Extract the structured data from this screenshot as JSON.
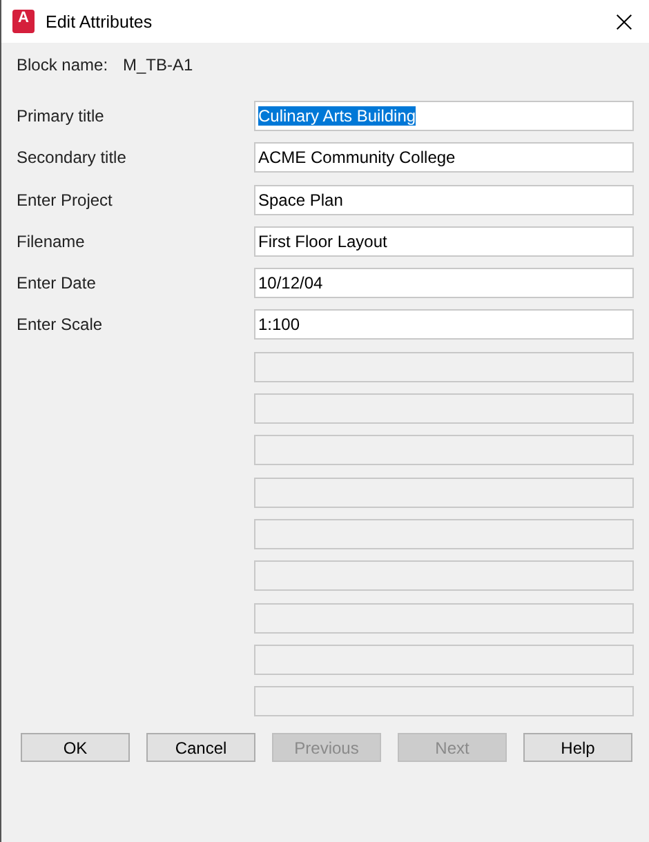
{
  "window": {
    "title": "Edit Attributes",
    "icon_letter": "A"
  },
  "block_name": {
    "label": "Block name:",
    "value": "M_TB-A1"
  },
  "fields": [
    {
      "label": "Primary title",
      "value": "Culinary Arts Building",
      "selected": true,
      "disabled": false
    },
    {
      "label": "Secondary title",
      "value": "ACME Community College",
      "selected": false,
      "disabled": false
    },
    {
      "label": "Enter Project",
      "value": "Space Plan",
      "selected": false,
      "disabled": false
    },
    {
      "label": "Filename",
      "value": "First Floor Layout",
      "selected": false,
      "disabled": false
    },
    {
      "label": "Enter Date",
      "value": "10/12/04",
      "selected": false,
      "disabled": false
    },
    {
      "label": "Enter Scale",
      "value": "1:100",
      "selected": false,
      "disabled": false
    },
    {
      "disabled": true
    },
    {
      "disabled": true
    },
    {
      "disabled": true
    },
    {
      "disabled": true
    },
    {
      "disabled": true
    },
    {
      "disabled": true
    },
    {
      "disabled": true
    },
    {
      "disabled": true
    },
    {
      "disabled": true
    }
  ],
  "buttons": [
    {
      "label": "OK",
      "disabled": false
    },
    {
      "label": "Cancel",
      "disabled": false
    },
    {
      "label": "Previous",
      "disabled": true
    },
    {
      "label": "Next",
      "disabled": true
    },
    {
      "label": "Help",
      "disabled": false
    }
  ]
}
